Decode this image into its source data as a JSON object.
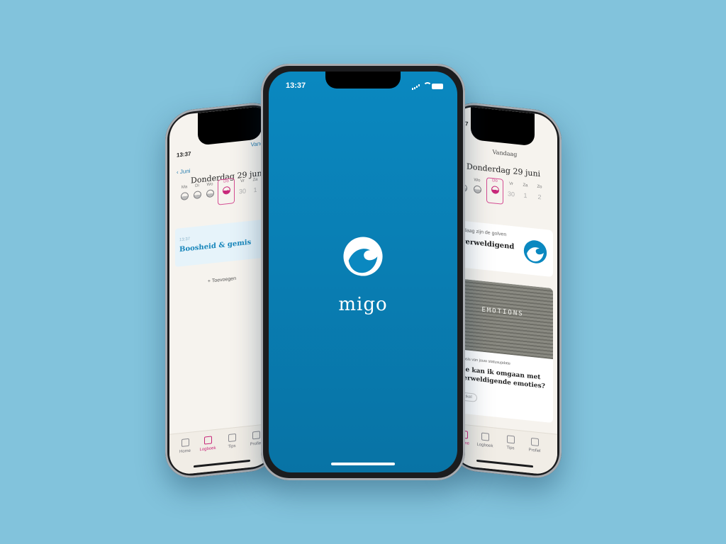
{
  "status_time": "13:37",
  "app": {
    "name": "migo"
  },
  "left_phone": {
    "back_label": "Juni",
    "top_action": "Vandaag",
    "date_title": "Donderdag 29 juni",
    "days": [
      {
        "label": "Ma"
      },
      {
        "label": "Di"
      },
      {
        "label": "Wo"
      },
      {
        "label": "Do"
      },
      {
        "label": "Vr",
        "num": "30"
      },
      {
        "label": "Za",
        "num": "1"
      }
    ],
    "entry": {
      "time": "13:37",
      "title": "Boosheid & gemis"
    },
    "add_label": "+ Toevoegen",
    "tabs": [
      {
        "label": "Home"
      },
      {
        "label": "Logboek"
      },
      {
        "label": "Tips"
      },
      {
        "label": "Profiel"
      }
    ]
  },
  "right_phone": {
    "header": "Vandaag",
    "date_title": "Donderdag 29 juni",
    "days": [
      {
        "label": "Di"
      },
      {
        "label": "Wo"
      },
      {
        "label": "Do"
      },
      {
        "label": "Vr",
        "num": "30"
      },
      {
        "label": "Za",
        "num": "1"
      },
      {
        "label": "Zo",
        "num": "2"
      }
    ],
    "waves_card": {
      "caption": "Vandaag zijn de golven",
      "value": "Overweldigend"
    },
    "article": {
      "image_text": "EMOTIONS",
      "source": "Op basis van jouw statusupdate",
      "title": "Hoe kan ik omgaan met overweldigende emoties?",
      "tag": "Artikel"
    },
    "tabs": [
      {
        "label": "Home"
      },
      {
        "label": "Logboek"
      },
      {
        "label": "Tips"
      },
      {
        "label": "Profiel"
      }
    ]
  },
  "colors": {
    "background": "#82c3dc",
    "brand_blue": "#0a88c0",
    "accent_pink": "#c8287a"
  }
}
